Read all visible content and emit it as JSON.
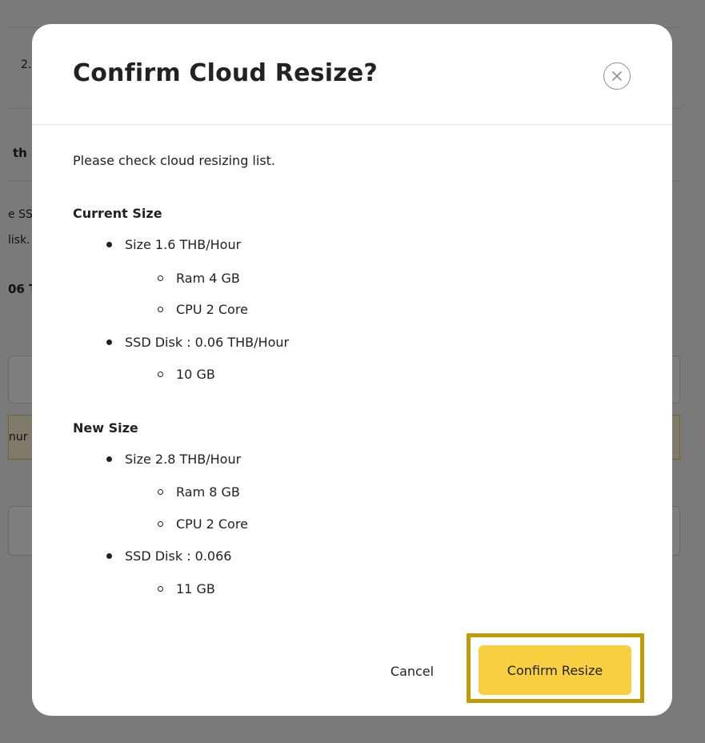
{
  "background": {
    "fragments": [
      "2.",
      "th",
      "e SS",
      "lisk.",
      "06 T",
      "nur"
    ]
  },
  "modal": {
    "title": "Confirm Cloud Resize?",
    "close_icon": "close-circle-icon",
    "instruction": "Please check cloud resizing list.",
    "current": {
      "heading": "Current Size",
      "size": "Size 1.6 THB/Hour",
      "ram": "Ram 4 GB",
      "cpu": "CPU 2 Core",
      "disk": "SSD Disk : 0.06 THB/Hour",
      "disk_size": "10 GB"
    },
    "new": {
      "heading": "New Size",
      "size": "Size 2.8 THB/Hour",
      "ram": "Ram 8 GB",
      "cpu": "CPU 2 Core",
      "disk": "SSD Disk : 0.066",
      "disk_size": "11 GB"
    },
    "buttons": {
      "cancel": "Cancel",
      "confirm": "Confirm Resize"
    }
  },
  "colors": {
    "overlay": "#000000",
    "confirm_button": "#f8cf40",
    "highlight_border": "#c29a06",
    "text": "#222222"
  }
}
